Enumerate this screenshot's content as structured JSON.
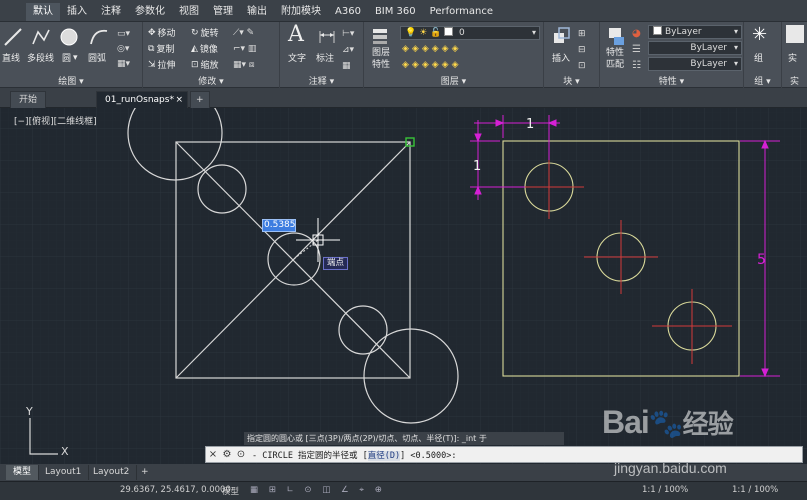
{
  "ribbon_tabs": [
    "默认",
    "插入",
    "注释",
    "参数化",
    "视图",
    "管理",
    "输出",
    "附加模块",
    "A360",
    "BIM 360",
    "Performance"
  ],
  "ribbon": {
    "draw": {
      "label": "绘图",
      "line": "直线",
      "polyline": "多段线",
      "circle": "圆",
      "arc": "圆弧"
    },
    "modify": {
      "label": "修改",
      "move": "移动",
      "rotate": "旋转",
      "copy": "复制",
      "mirror": "镜像",
      "stretch": "拉伸",
      "scale": "缩放"
    },
    "annotation": {
      "label": "注释",
      "text": "文字",
      "dimension": "标注"
    },
    "layers": {
      "label": "图层",
      "layer_props": "图层",
      "layer_props2": "特性",
      "current_layer": "0"
    },
    "block": {
      "label": "块",
      "insert": "插入"
    },
    "properties": {
      "label": "特性",
      "match": "特性",
      "match2": "匹配",
      "color": "ByLayer",
      "linetype": "ByLayer",
      "lineweight": "ByLayer"
    },
    "groups": {
      "label": "组",
      "group": "组"
    },
    "utilities": {
      "label": "实",
      "measure": "实"
    }
  },
  "file_tabs": {
    "start": "开始",
    "drawing": "01_runOsnaps*",
    "close": "×",
    "add": "+"
  },
  "viewport_label": "[−][俯视][二维线框]",
  "drawing": {
    "input_value": "0.5385",
    "snap_tooltip": "端点",
    "dim_top": "1",
    "dim_left": "1",
    "dim_right": "5",
    "ucs_x": "X",
    "ucs_y": "Y"
  },
  "command": {
    "hint": "指定圆的圆心或 [三点(3P)/两点(2P)/切点、切点、半径(T)]: _int 于",
    "prompt_icon": "⊙",
    "line_prefix": "- CIRCLE 指定圆的半径或 [",
    "line_option": "直径(D)",
    "line_suffix": "] <0.5000>:",
    "close_icon": "×",
    "settings_icon": "🔧"
  },
  "layout_tabs": [
    "模型",
    "Layout1",
    "Layout2"
  ],
  "layout_add": "+",
  "status": {
    "coords": "29.6367, 25.4617, 0.0000",
    "model": "模型",
    "scale1": "1:1 / 100%",
    "scale2": "1:1 / 100%"
  },
  "watermark": {
    "brand": "Bai",
    "brand2": "经验",
    "url": "jingyan.baidu.com"
  },
  "colors": {
    "canvas": "#212830",
    "white_lines": "#d8d8d8",
    "yellow": "#d9d99a",
    "red": "#d23a3a",
    "magenta": "#d520d5",
    "snap_green": "#39c439"
  }
}
